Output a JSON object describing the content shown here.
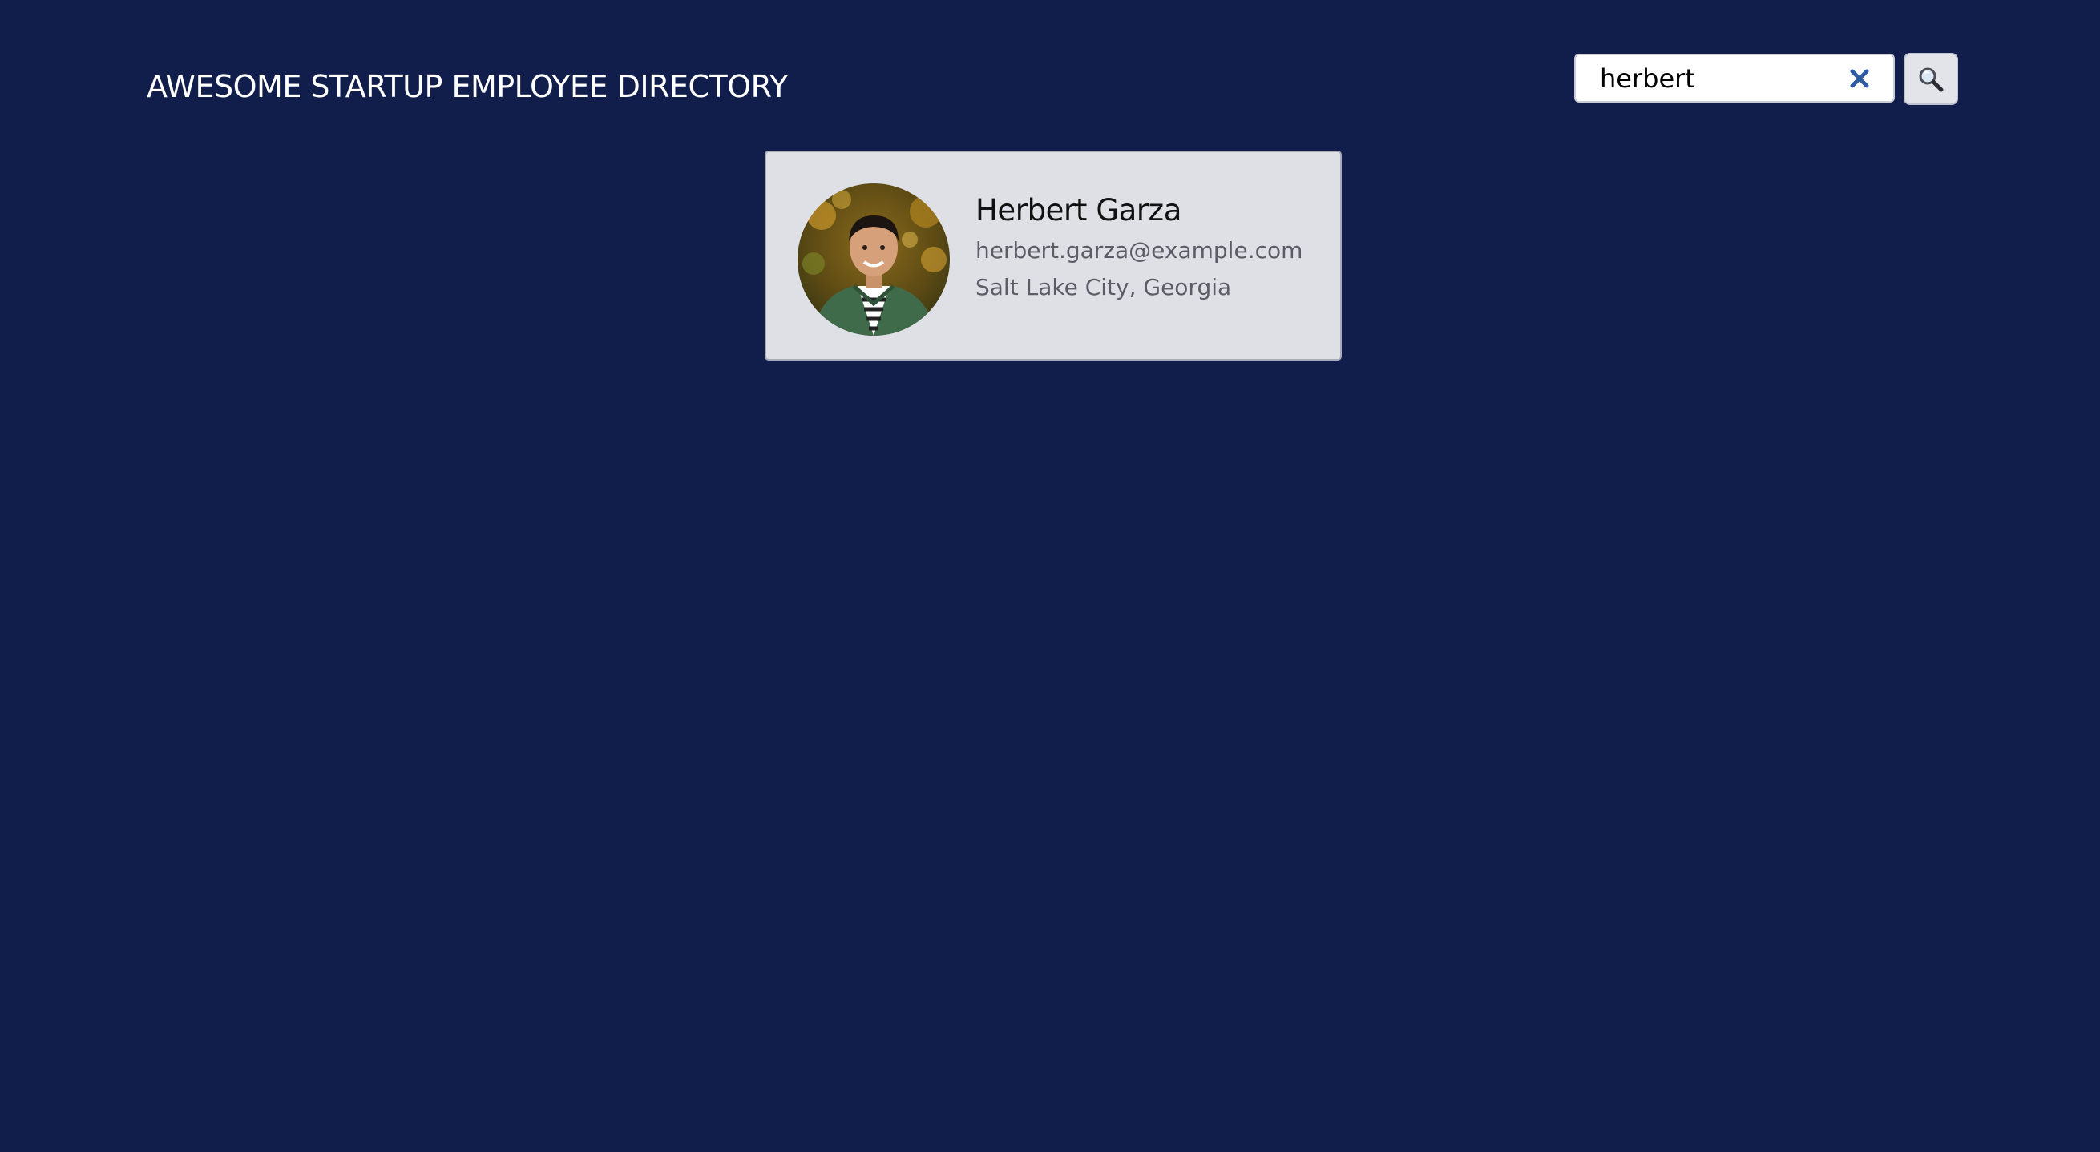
{
  "header": {
    "title": "AWESOME STARTUP EMPLOYEE DIRECTORY"
  },
  "search": {
    "value": "herbert",
    "clear_icon": "close-icon",
    "button_icon": "magnifier-icon"
  },
  "results": [
    {
      "name": "Herbert Garza",
      "email": "herbert.garza@example.com",
      "location": "Salt Lake City, Georgia",
      "avatar_icon": "person-photo"
    }
  ],
  "colors": {
    "background": "#111d4a",
    "card": "#dfe0e6",
    "clear_icon": "#2d5aa0"
  }
}
